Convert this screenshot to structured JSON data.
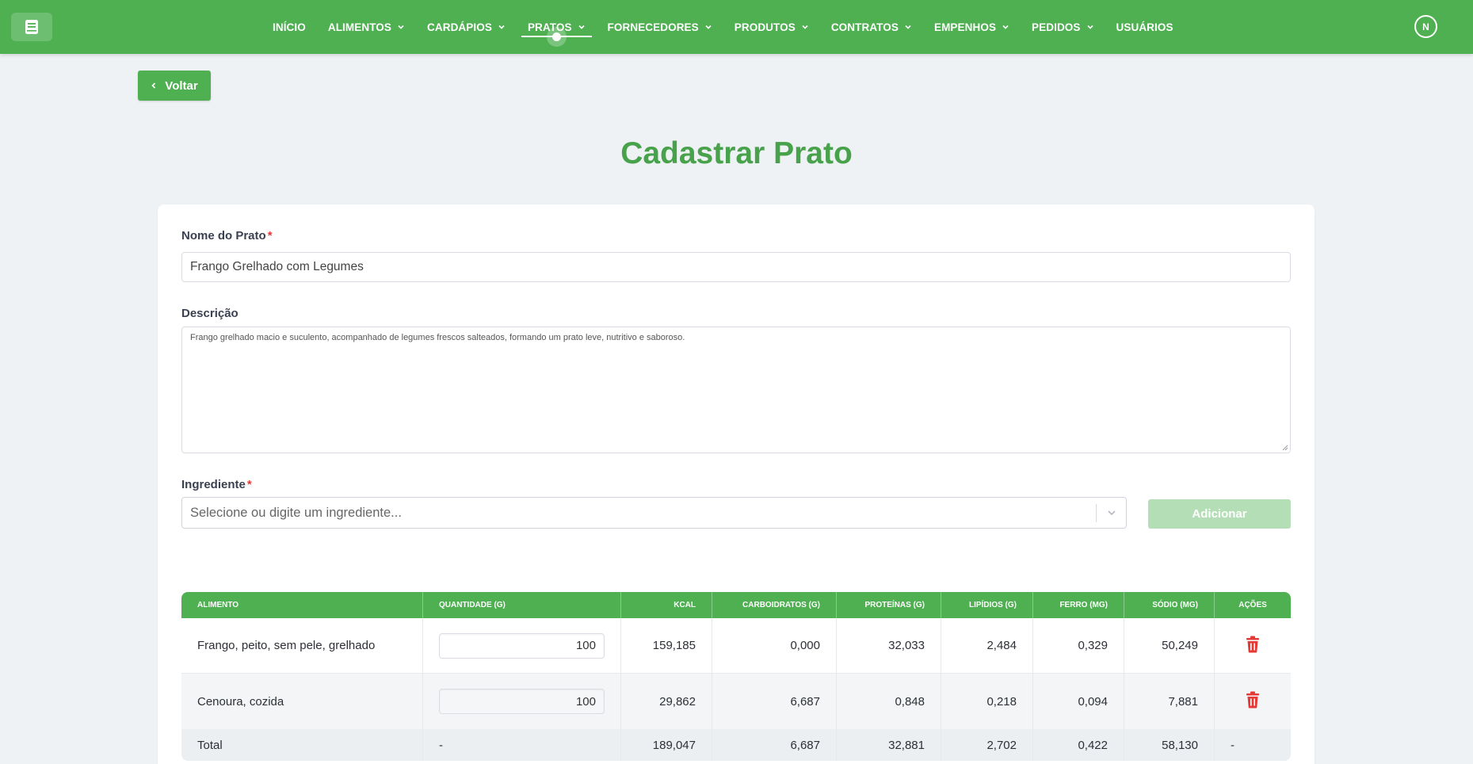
{
  "nav": {
    "items": [
      {
        "label": "INÍCIO",
        "dropdown": false,
        "active": false
      },
      {
        "label": "ALIMENTOS",
        "dropdown": true,
        "active": false
      },
      {
        "label": "CARDÁPIOS",
        "dropdown": true,
        "active": false
      },
      {
        "label": "PRATOS",
        "dropdown": true,
        "active": true
      },
      {
        "label": "FORNECEDORES",
        "dropdown": true,
        "active": false
      },
      {
        "label": "PRODUTOS",
        "dropdown": true,
        "active": false
      },
      {
        "label": "CONTRATOS",
        "dropdown": true,
        "active": false
      },
      {
        "label": "EMPENHOS",
        "dropdown": true,
        "active": false
      },
      {
        "label": "PEDIDOS",
        "dropdown": true,
        "active": false
      },
      {
        "label": "USUÁRIOS",
        "dropdown": false,
        "active": false
      }
    ],
    "avatar_initial": "N"
  },
  "back_button": {
    "label": "Voltar"
  },
  "page": {
    "title": "Cadastrar Prato"
  },
  "form": {
    "name_label": "Nome do Prato",
    "name_value": "Frango Grelhado com Legumes",
    "required_mark": "*",
    "description_label": "Descrição",
    "description_value": "Frango grelhado macio e suculento, acompanhado de legumes frescos salteados, formando um prato leve, nutritivo e saboroso.",
    "ingredient_label": "Ingrediente",
    "ingredient_placeholder": "Selecione ou digite um ingrediente...",
    "add_button": "Adicionar"
  },
  "table": {
    "headers": [
      "ALIMENTO",
      "QUANTIDADE (G)",
      "KCAL",
      "CARBOIDRATOS (G)",
      "PROTEÍNAS (G)",
      "LIPÍDIOS (G)",
      "FERRO (MG)",
      "SÓDIO (MG)",
      "AÇÕES"
    ],
    "rows": [
      {
        "alimento": "Frango, peito, sem pele, grelhado",
        "quantidade": "100",
        "kcal": "159,185",
        "carboidratos": "0,000",
        "proteinas": "32,033",
        "lipidios": "2,484",
        "ferro": "0,329",
        "sodio": "50,249"
      },
      {
        "alimento": "Cenoura, cozida",
        "quantidade": "100",
        "kcal": "29,862",
        "carboidratos": "6,687",
        "proteinas": "0,848",
        "lipidios": "0,218",
        "ferro": "0,094",
        "sodio": "7,881"
      }
    ],
    "total": {
      "label": "Total",
      "quantidade": "-",
      "kcal": "189,047",
      "carboidratos": "6,687",
      "proteinas": "32,881",
      "lipidios": "2,702",
      "ferro": "0,422",
      "sodio": "58,130",
      "acoes": "-"
    }
  },
  "colors": {
    "brand_green": "#4fb052",
    "title_green": "#48a14b",
    "danger_red": "#e53935",
    "disabled_green": "#b4deb5"
  }
}
